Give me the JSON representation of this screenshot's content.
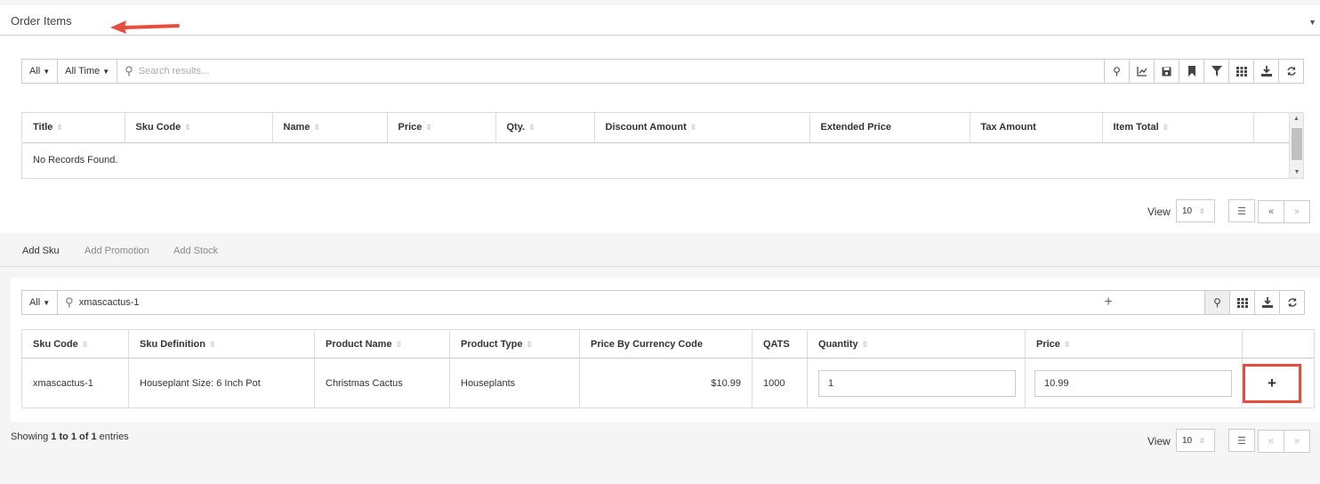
{
  "panel": {
    "title": "Order Items"
  },
  "toolbar": {
    "filter_label": "All",
    "time_label": "All Time",
    "search_placeholder": "Search results..."
  },
  "order_table": {
    "columns": [
      "Title",
      "Sku Code",
      "Name",
      "Price",
      "Qty.",
      "Discount Amount",
      "Extended Price",
      "Tax Amount",
      "Item Total"
    ],
    "empty_message": "No Records Found."
  },
  "pagination": {
    "view_label": "View",
    "page_size": "10",
    "prev": "«",
    "next": "»"
  },
  "tabs": [
    "Add Sku",
    "Add Promotion",
    "Add Stock"
  ],
  "sku_search": {
    "filter_label": "All",
    "value": "xmascactus-1"
  },
  "sku_table": {
    "columns": [
      "Sku Code",
      "Sku Definition",
      "Product Name",
      "Product Type",
      "Price By Currency Code",
      "QATS",
      "Quantity",
      "Price"
    ],
    "row": {
      "sku_code": "xmascactus-1",
      "sku_definition": "Houseplant Size: 6 Inch Pot",
      "product_name": "Christmas Cactus",
      "product_type": "Houseplants",
      "price_by_currency": "$10.99",
      "qats": "1000",
      "quantity": "1",
      "price": "10.99"
    }
  },
  "showing": {
    "prefix": "Showing ",
    "range": "1 to 1 of 1",
    "suffix": " entries"
  },
  "colors": {
    "annotation": "#e74c3c"
  },
  "icons": [
    "search-icon",
    "chart-icon",
    "save-icon",
    "bookmark-icon",
    "filter-icon",
    "grid-icon",
    "download-icon",
    "refresh-icon",
    "plus-icon",
    "list-icon"
  ]
}
